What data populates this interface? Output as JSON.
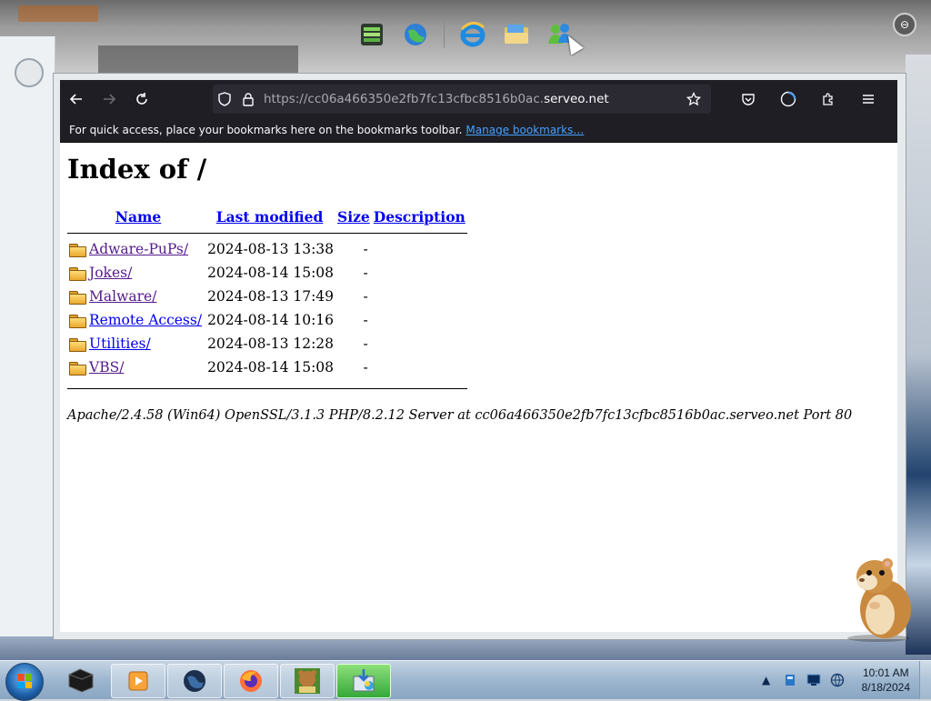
{
  "browser": {
    "url_scheme": "https://cc06a466350e2fb7fc13cfbc8516b0ac.",
    "url_host": "serveo.net",
    "bookmarks_bar": {
      "message": "For quick access, place your bookmarks here on the bookmarks toolbar.",
      "link": "Manage bookmarks…"
    }
  },
  "page": {
    "title": "Index of /",
    "columns": {
      "name": "Name",
      "last_modified": "Last modified",
      "size": "Size",
      "description": "Description"
    },
    "rows": [
      {
        "name": "Adware-PuPs/",
        "modified": "2024-08-13 13:38",
        "size": "-"
      },
      {
        "name": "Jokes/",
        "modified": "2024-08-14 15:08",
        "size": "-"
      },
      {
        "name": "Malware/",
        "modified": "2024-08-13 17:49",
        "size": "-"
      },
      {
        "name": "Remote Access/",
        "modified": "2024-08-14 10:16",
        "size": "-"
      },
      {
        "name": "Utilities/",
        "modified": "2024-08-13 12:28",
        "size": "-"
      },
      {
        "name": "VBS/",
        "modified": "2024-08-14 15:08",
        "size": "-"
      }
    ],
    "server_signature": "Apache/2.4.58 (Win64) OpenSSL/3.1.3 PHP/8.2.12 Server at cc06a466350e2fb7fc13cfbc8516b0ac.serveo.net Port 80"
  },
  "dock": {
    "icons": [
      "archive-icon",
      "globe-icon",
      "internet-explorer-icon",
      "file-explorer-icon",
      "messenger-icon"
    ]
  },
  "taskbar": {
    "items": [
      "terminal-icon",
      "media-player-icon",
      "globe-icon",
      "firefox-icon",
      "bearbox-icon",
      "installer-icon"
    ],
    "clock_time": "10:01 AM",
    "clock_date": "8/18/2024"
  },
  "colors": {
    "toolbar_bg": "#1f1e25",
    "link": "#0000ee",
    "visited_link": "#551a8b",
    "bookmark_link": "#45a1ff"
  }
}
